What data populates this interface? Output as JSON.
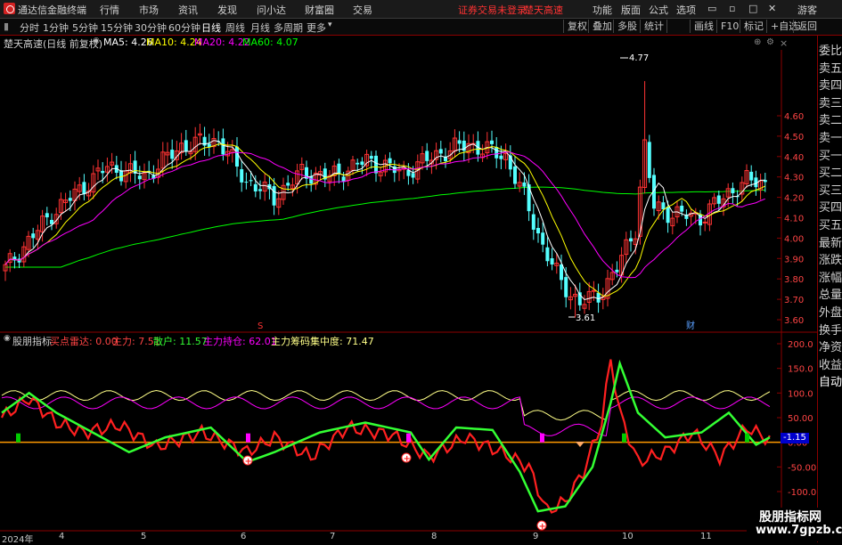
{
  "menubar": {
    "app_title": "通达信金融终端",
    "menus": [
      "行情",
      "市场",
      "资讯",
      "行情",
      "发现",
      "问小达",
      "财富圈",
      "交易"
    ],
    "status": "证券交易未登录",
    "stock_name": "楚天高速",
    "right_menus": [
      "功能",
      "版面",
      "公式",
      "选项"
    ],
    "user": "游客",
    "brand_color": "#d32222"
  },
  "periodbar": {
    "tabs": [
      "分时",
      "1分钟",
      "5分钟",
      "15分钟",
      "30分钟",
      "60分钟",
      "日线",
      "周线",
      "月线",
      "多周期",
      "更多"
    ],
    "active_tab": "日线",
    "right_buttons": [
      "复权",
      "叠加",
      "多股",
      "统计",
      "画线",
      "F10",
      "标记",
      "+自选",
      "返回"
    ]
  },
  "infoline": {
    "title": "楚天高速(日线 前复权)",
    "ma5": "MA5: 4.26",
    "ma10": "MA10: 4.24",
    "ma20": "MA20: 4.22",
    "ma60": "MA60: 4.07"
  },
  "price_axis": [
    "4.60",
    "4.50",
    "4.40",
    "4.30",
    "4.20",
    "4.10",
    "4.00",
    "3.90",
    "3.80",
    "3.70",
    "3.60"
  ],
  "annotations": {
    "high": "4.77",
    "low": "3.61",
    "event_red": "S",
    "event_blue": "财"
  },
  "indicator": {
    "name": "股朋指标",
    "buy_radar": "买点雷达: 0.00",
    "main_force": "主力: 7.51",
    "retail": "散户: 11.57",
    "position": "主力持仓: 62.01",
    "concentration": "主力筹码集中度: 71.47",
    "current_value": "-1.15",
    "axis": [
      "200.0",
      "150.0",
      "100.0",
      "50.00",
      "0.00",
      "-50.00",
      "-100.0"
    ]
  },
  "side_panel": [
    "委比",
    "卖五",
    "卖四",
    "卖三",
    "卖二",
    "卖一",
    "买一",
    "买二",
    "买三",
    "买四",
    "买五",
    "最新",
    "涨跌",
    "涨幅",
    "总量",
    "外盘",
    "换手",
    "净资",
    "收益",
    "自动"
  ],
  "date_axis": [
    "2024年",
    "4",
    "5",
    "6",
    "7",
    "8",
    "9",
    "10",
    "11"
  ],
  "watermark": {
    "line1": "股朋指标网",
    "line2": "www.7gpzb.com"
  },
  "colors": {
    "up": "#ff3333",
    "down": "#54ffff",
    "ma5": "#ffffff",
    "ma10": "#ffff00",
    "ma20": "#ff00ff",
    "ma60": "#00ff00",
    "main_force_line": "#ff2020",
    "retail_line": "#33ff33",
    "axis_red": "#8b0000"
  }
}
